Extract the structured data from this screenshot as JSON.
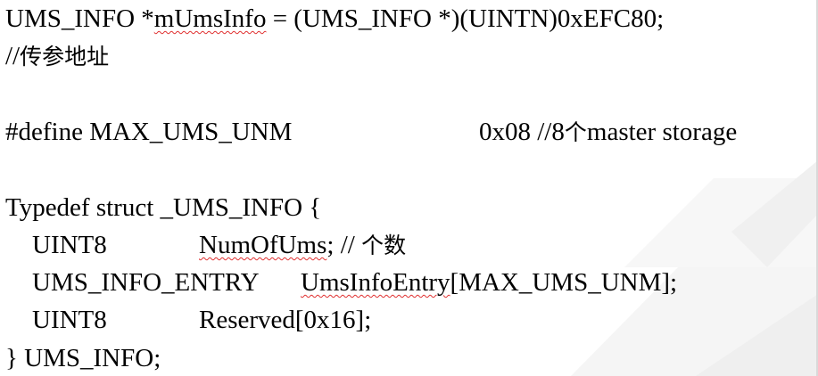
{
  "code": {
    "line1": {
      "type_name": "UMS_INFO *",
      "var_name": "mUmsInfo",
      "rest": " = (UMS_INFO *)(UINTN)0xEFC80;"
    },
    "line2": {
      "prefix": "//",
      "comment_cjk": "传参地址"
    },
    "line3": {
      "directive": "#define MAX_UMS_UNM",
      "value": "0x08 //8",
      "cjk": "个",
      "tail": "master storage"
    },
    "line4": {
      "text": "Typedef struct _UMS_INFO {"
    },
    "line5": {
      "type": "UINT8",
      "field": "NumOfUms",
      "after": "; // ",
      "cjk": "个数"
    },
    "line6": {
      "type": "UMS_INFO_ENTRY",
      "field": "UmsInfoEntry",
      "after": "[MAX_UMS_UNM];"
    },
    "line7": {
      "type": "UINT8",
      "field": "Reserved[0x16];"
    },
    "line8": {
      "text": "} UMS_INFO;"
    }
  },
  "colors": {
    "text": "#000000",
    "spellcheck_underline": "#e03030",
    "background": "#ffffff",
    "decoration": "#f2f2f2"
  }
}
